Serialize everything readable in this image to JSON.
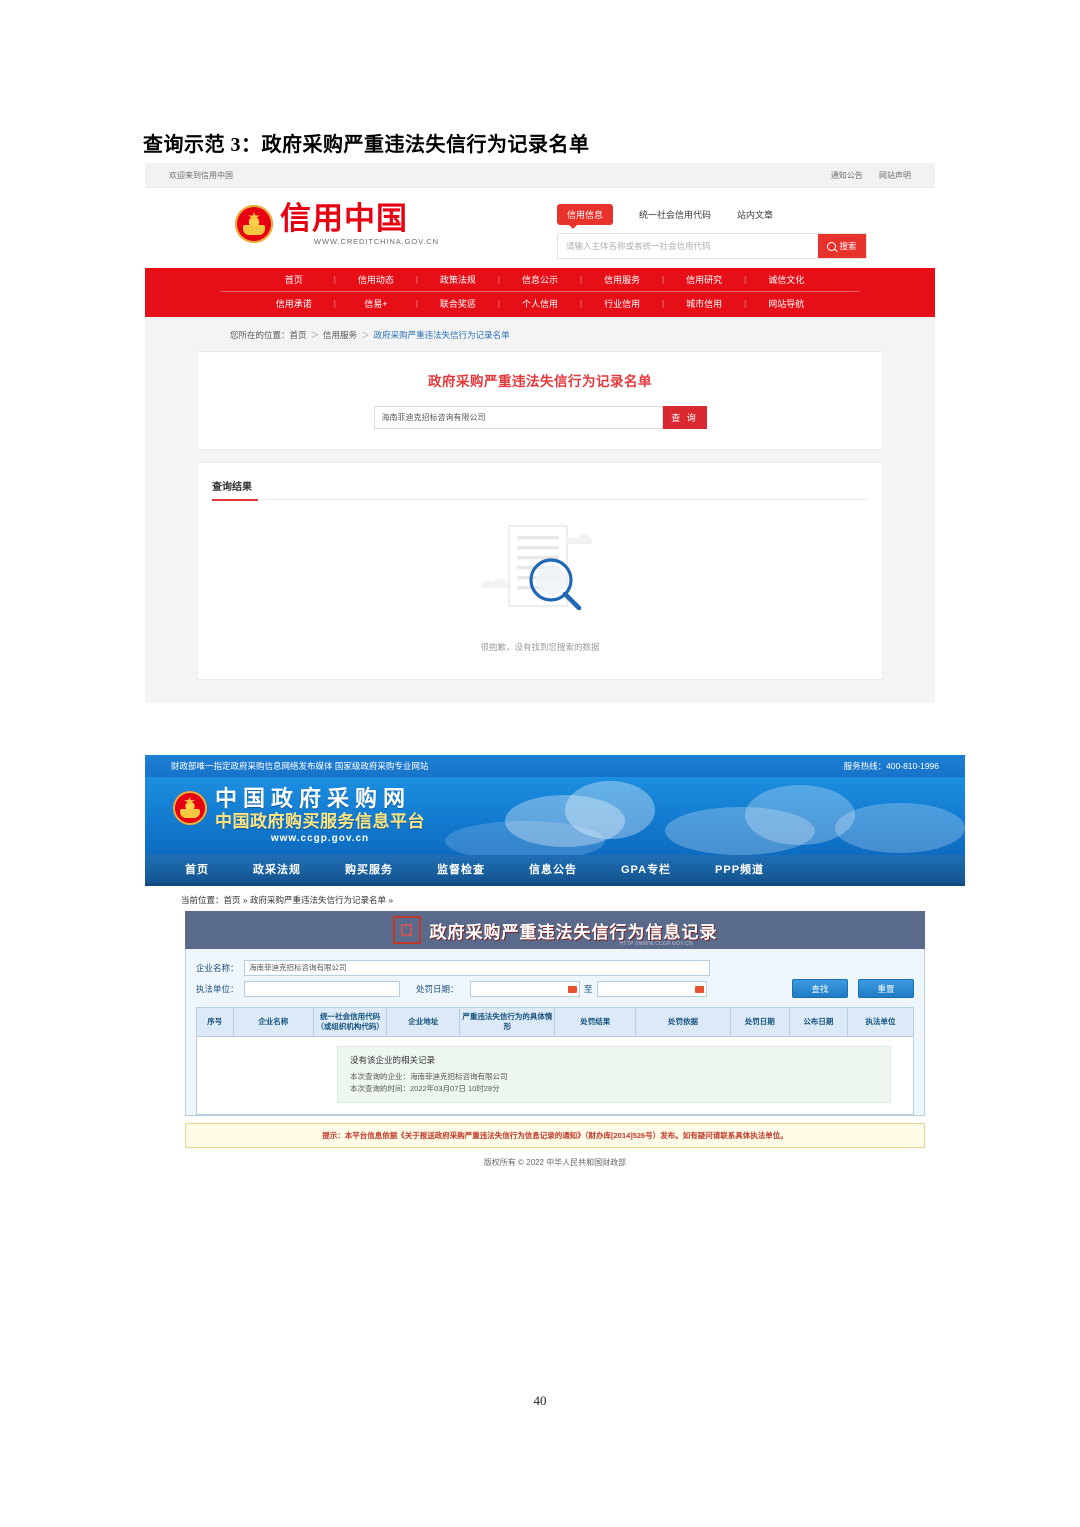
{
  "document": {
    "heading": "查询示范 3：政府采购严重违法失信行为记录名单",
    "page_number": "40"
  },
  "creditchina": {
    "topbar": {
      "welcome": "欢迎来到信用中国",
      "links": [
        "通知公告",
        "网站声明"
      ]
    },
    "logo": {
      "name": "信用中国",
      "url": "WWW.CREDITCHINA.GOV.CN"
    },
    "search": {
      "tabs": [
        "信用信息",
        "统一社会信用代码",
        "站内文章"
      ],
      "active_tab": "信用信息",
      "placeholder": "请输入主体名称或者统一社会信用代码",
      "button": "搜索"
    },
    "nav_row1": [
      "首页",
      "信用动态",
      "政策法规",
      "信息公示",
      "信用服务",
      "信用研究",
      "诚信文化"
    ],
    "nav_row2": [
      "信用承诺",
      "信易+",
      "联合奖惩",
      "个人信用",
      "行业信用",
      "城市信用",
      "网站导航"
    ],
    "breadcrumb": {
      "prefix": "您所在的位置：",
      "items": [
        "首页",
        "信用服务",
        "政府采购严重违法失信行为记录名单"
      ],
      "separator": "＞"
    },
    "panel": {
      "title": "政府采购严重违法失信行为记录名单",
      "input_value": "海南菲迪克招标咨询有限公司",
      "button": "查 询"
    },
    "results": {
      "title": "查询结果",
      "empty_text": "很抱歉，没有找到您搜索的数据"
    }
  },
  "ccgp": {
    "topstrip": {
      "slogan": "财政部唯一指定政府采购信息网络发布媒体 国家级政府采购专业网站",
      "hotline": "服务热线：400-810-1996"
    },
    "banner": {
      "line1": "中国政府采购网",
      "line2": "中国政府购买服务信息平台",
      "line3": "www.ccgp.gov.cn"
    },
    "nav": [
      "首页",
      "政采法规",
      "购买服务",
      "监督检查",
      "信息公告",
      "GPA专栏",
      "PPP频道"
    ],
    "breadcrumb": "当前位置：首页 » 政府采购严重违法失信行为记录名单 »",
    "title_bar": {
      "text": "政府采购严重违法失信行为信息记录",
      "url": "HTTP://WWW.CCGP.GOV.CN"
    },
    "form": {
      "company_label": "企业名称：",
      "company_value": "海南菲迪克招标咨询有限公司",
      "agency_label": "执法单位：",
      "agency_value": "",
      "date_label": "处罚日期：",
      "date_from": "",
      "date_to": "",
      "date_between": "至",
      "search_button": "查找",
      "reset_button": "重置"
    },
    "table_headers": [
      "序号",
      "企业名称",
      "统一社会信用代码（或组织机构代码）",
      "企业地址",
      "严重违法失信行为的具体情形",
      "处罚结果",
      "处罚依据",
      "处罚日期",
      "公布日期",
      "执法单位"
    ],
    "result": {
      "headline": "没有该企业的相关记录",
      "queried_company": "本次查询的企业：海南菲迪克招标咨询有限公司",
      "queried_time": "本次查询的时间：2022年03月07日 10时28分"
    },
    "notice": "提示：本平台信息依据《关于报送政府采购严重违法失信行为信息记录的通知》（财办库[2014]526号）发布。如有疑问请联系具体执法单位。",
    "footer": "版权所有 © 2022 中华人民共和国财政部"
  }
}
